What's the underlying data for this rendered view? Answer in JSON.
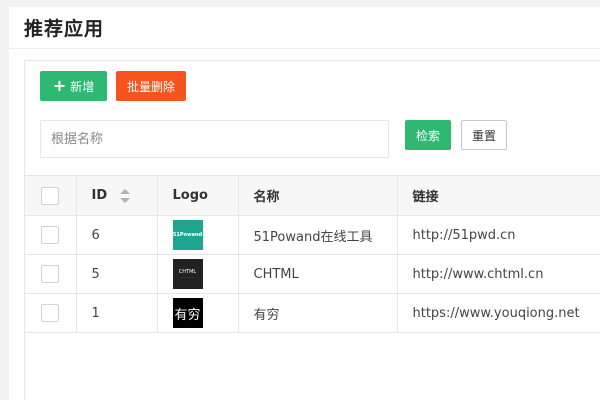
{
  "page": {
    "title": "推荐应用"
  },
  "toolbar": {
    "add_icon": "plus-icon",
    "add_label": "新增",
    "batch_delete_label": "批量删除"
  },
  "search": {
    "placeholder": "根据名称",
    "value": "",
    "search_label": "检索",
    "reset_label": "重置"
  },
  "table": {
    "headers": {
      "id": "ID",
      "logo": "Logo",
      "name": "名称",
      "link": "链接"
    },
    "rows": [
      {
        "id": "6",
        "logo_text": "51Powand",
        "name": "51Powand在线工具",
        "link": "http://51pwd.cn"
      },
      {
        "id": "5",
        "logo_text": "CHTML",
        "name": "CHTML",
        "link": "http://www.chtml.cn"
      },
      {
        "id": "1",
        "logo_text": "有穷",
        "name": "有穷",
        "link": "https://www.youqiong.net"
      }
    ]
  },
  "colors": {
    "primary": "#2eb872",
    "danger": "#f6541e",
    "header_bg": "#f7f7f7"
  }
}
